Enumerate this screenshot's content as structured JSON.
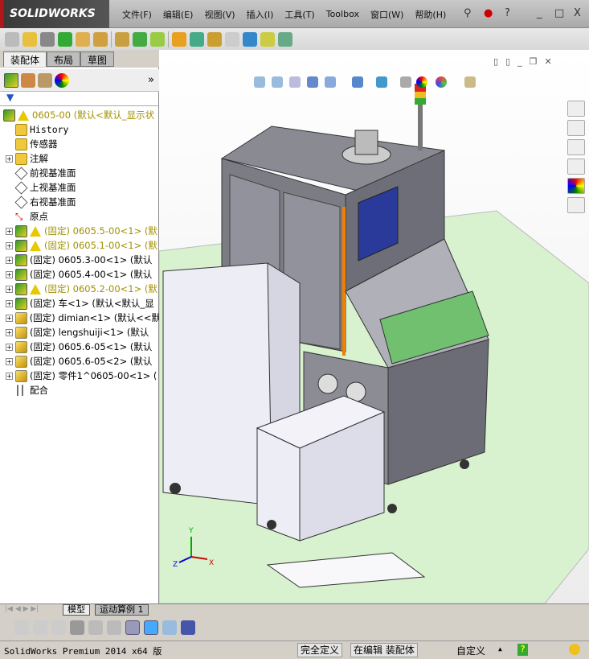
{
  "app": {
    "logo": "SOLIDWORKS",
    "menus": [
      "文件(F)",
      "编辑(E)",
      "视图(V)",
      "插入(I)",
      "工具(T)",
      "Toolbox",
      "窗口(W)",
      "帮助(H)"
    ],
    "help": "?",
    "minimize": "_",
    "restore": "□",
    "close": "X"
  },
  "left_panel": {
    "tabs": [
      "装配体",
      "布局",
      "草图"
    ],
    "filter_icon": "▼",
    "tree": [
      {
        "label": "0605-00  (默认<默认_显示状",
        "icon": "assembly",
        "warn": true,
        "expand": false,
        "color": "yellow"
      },
      {
        "label": "History",
        "icon": "history",
        "expand": false
      },
      {
        "label": "传感器",
        "icon": "sensor",
        "expand": false
      },
      {
        "label": "注解",
        "icon": "annotation",
        "expand": true
      },
      {
        "label": "前视基准面",
        "icon": "plane",
        "expand": false
      },
      {
        "label": "上视基准面",
        "icon": "plane",
        "expand": false
      },
      {
        "label": "右视基准面",
        "icon": "plane",
        "expand": false
      },
      {
        "label": "原点",
        "icon": "origin",
        "expand": false
      },
      {
        "label": "(固定) 0605.5-00<1> (默",
        "icon": "assembly",
        "warn": true,
        "expand": true,
        "color": "yellow"
      },
      {
        "label": "(固定) 0605.1-00<1> (默",
        "icon": "assembly",
        "warn": true,
        "expand": true,
        "color": "yellow"
      },
      {
        "label": "(固定) 0605.3-00<1> (默认",
        "icon": "assembly",
        "expand": true
      },
      {
        "label": "(固定) 0605.4-00<1> (默认",
        "icon": "assembly",
        "expand": true
      },
      {
        "label": "(固定) 0605.2-00<1> (默",
        "icon": "assembly",
        "warn": true,
        "expand": true,
        "color": "yellow"
      },
      {
        "label": "(固定) 车<1> (默认<默认_显",
        "icon": "assembly",
        "expand": true
      },
      {
        "label": "(固定) dimian<1> (默认<<默",
        "icon": "part",
        "expand": true
      },
      {
        "label": "(固定) lengshuiji<1> (默认",
        "icon": "part",
        "expand": true
      },
      {
        "label": "(固定) 0605.6-05<1> (默认",
        "icon": "part",
        "expand": true
      },
      {
        "label": "(固定) 0605.6-05<2> (默认",
        "icon": "part",
        "expand": true
      },
      {
        "label": "(固定) 零件1^0605-00<1> (",
        "icon": "part",
        "expand": true
      },
      {
        "label": "配合",
        "icon": "mates",
        "expand": false
      }
    ]
  },
  "bottom_tabs": [
    "模型",
    "运动算例 1"
  ],
  "status": {
    "product": "SolidWorks Premium 2014 x64 版",
    "defined": "完全定义",
    "editing": "在编辑 装配体",
    "units": "自定义",
    "arrow": "▲",
    "help": "?"
  },
  "triad": {
    "x": "X",
    "y": "Y",
    "z": "Z"
  },
  "colors": {
    "floor": "#d8f2d0",
    "machine": "#7a7a80",
    "panel": "#ecedf5",
    "accent": "#f08000"
  }
}
